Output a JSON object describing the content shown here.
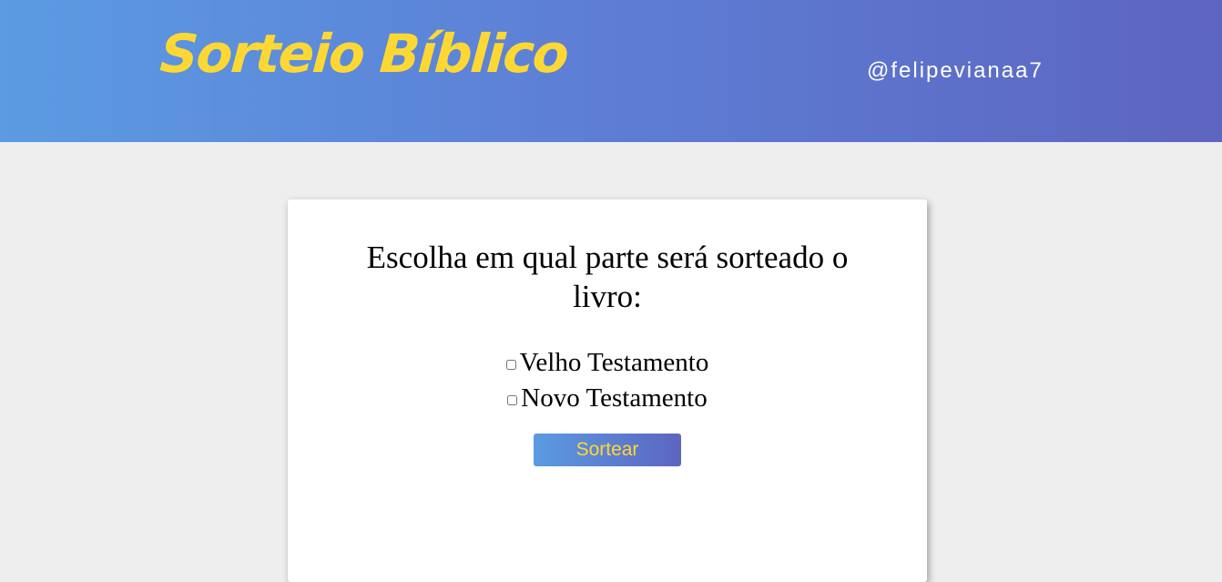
{
  "header": {
    "logo_text": "Sorteio Bíblico",
    "handle": "@felipevianaa7"
  },
  "card": {
    "question": "Escolha em qual parte será sorteado o livro:",
    "options": [
      {
        "label": "Velho Testamento",
        "checked": false
      },
      {
        "label": "Novo Testamento",
        "checked": false
      }
    ],
    "button_label": "Sortear"
  },
  "colors": {
    "header_gradient_start": "#5b9be2",
    "header_gradient_end": "#5d65c0",
    "logo_yellow": "#fdd835",
    "page_background": "#eeeeee"
  }
}
